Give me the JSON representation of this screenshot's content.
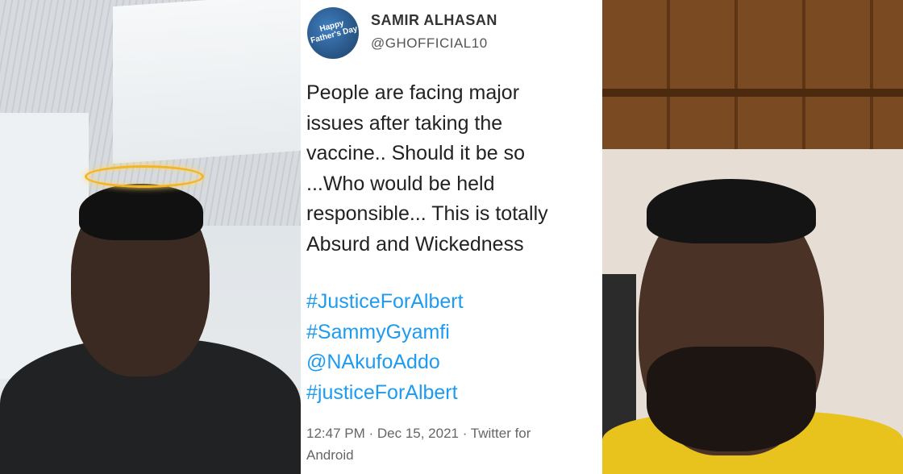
{
  "tweet": {
    "avatar_text": "Happy Father's Day",
    "display_name": "SAMIR ALHASAN",
    "handle": "@GHOFFICIAL10",
    "body_lines": [
      "People are facing major",
      "issues after taking the",
      "vaccine.. Should it be so",
      "...Who would be held",
      "responsible... This is totally",
      "Absurd and Wickedness"
    ],
    "tags": [
      "#JusticeForAlbert",
      "#SammyGyamfi",
      "@NAkufoAddo",
      "#justiceForAlbert"
    ],
    "meta_line1": "12:47 PM · Dec 15, 2021 · Twitter for",
    "meta_line2": "Android",
    "link_color": "#1d9bf0"
  }
}
